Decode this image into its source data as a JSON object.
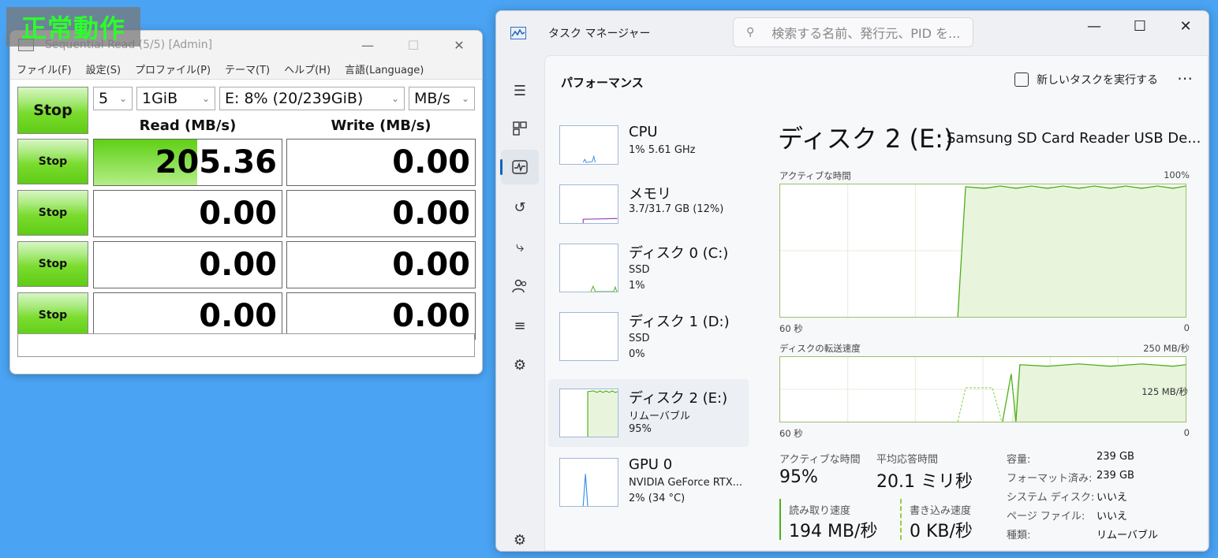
{
  "cdm": {
    "title": "Sequential Read (5/5) [Admin]",
    "overlay": "正常動作",
    "menu": [
      "ファイル(F)",
      "設定(S)",
      "プロファイル(P)",
      "テーマ(T)",
      "ヘルプ(H)",
      "言語(Language)"
    ],
    "main_stop": "Stop",
    "count": "5",
    "size": "1GiB",
    "drive": "E: 8% (20/239GiB)",
    "unit": "MB/s",
    "read_header": "Read (MB/s)",
    "write_header": "Write (MB/s)",
    "rows": [
      {
        "stop": "Stop",
        "read": "205.36",
        "write": "0.00",
        "read_fill": 0.55
      },
      {
        "stop": "Stop",
        "read": "0.00",
        "write": "0.00",
        "read_fill": 0
      },
      {
        "stop": "Stop",
        "read": "0.00",
        "write": "0.00",
        "read_fill": 0
      },
      {
        "stop": "Stop",
        "read": "0.00",
        "write": "0.00",
        "read_fill": 0
      }
    ],
    "status": ""
  },
  "tm": {
    "title": "タスク マネージャー",
    "search_placeholder": "検索する名前、発行元、PID を...",
    "section": "パフォーマンス",
    "new_task": "新しいタスクを実行する",
    "items": [
      {
        "name": "CPU",
        "sub1": "1%  5.61 GHz",
        "sub2": ""
      },
      {
        "name": "メモリ",
        "sub1": "3.7/31.7 GB (12%)",
        "sub2": ""
      },
      {
        "name": "ディスク 0 (C:)",
        "sub1": "SSD",
        "sub2": "1%"
      },
      {
        "name": "ディスク 1 (D:)",
        "sub1": "SSD",
        "sub2": "0%"
      },
      {
        "name": "ディスク 2 (E:)",
        "sub1": "リムーバブル",
        "sub2": "95%"
      },
      {
        "name": "GPU 0",
        "sub1": "NVIDIA GeForce RTX...",
        "sub2": "2%  (34 °C)"
      }
    ],
    "detail": {
      "title": "ディスク 2 (E:)",
      "model": "Samsung SD Card Reader USB De...",
      "graph1_label": "アクティブな時間",
      "graph1_max": "100%",
      "graph1_xleft": "60 秒",
      "graph1_xright": "0",
      "graph2_label": "ディスクの転送速度",
      "graph2_max": "250 MB/秒",
      "graph2_mid": "125 MB/秒",
      "graph2_xleft": "60 秒",
      "graph2_xright": "0",
      "active_label": "アクティブな時間",
      "active_val": "95%",
      "resp_label": "平均応答時間",
      "resp_val": "20.1 ミリ秒",
      "read_label": "読み取り速度",
      "read_val": "194 MB/秒",
      "write_label": "書き込み速度",
      "write_val": "0 KB/秒",
      "kv": [
        {
          "k": "容量:",
          "v": "239 GB"
        },
        {
          "k": "フォーマット済み:",
          "v": "239 GB"
        },
        {
          "k": "システム ディスク:",
          "v": "いいえ"
        },
        {
          "k": "ページ ファイル:",
          "v": "いいえ"
        },
        {
          "k": "種類:",
          "v": "リムーバブル"
        }
      ]
    }
  }
}
